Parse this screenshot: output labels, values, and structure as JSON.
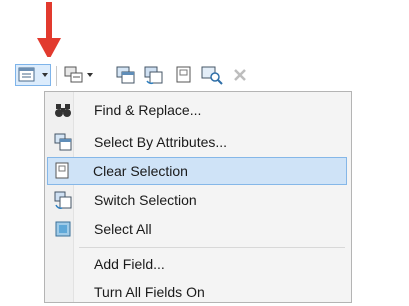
{
  "colors": {
    "arrow": "#e23a2e",
    "highlight": "#cfe3f7",
    "highlight_border": "#85b7e8"
  },
  "toolbar": {
    "buttons": [
      {
        "icon": "table-options-icon"
      },
      {
        "icon": "related-tables-icon"
      },
      {
        "icon": "select-by-attributes-icon"
      },
      {
        "icon": "switch-selection-icon"
      },
      {
        "icon": "clear-selection-icon"
      },
      {
        "icon": "zoom-to-selected-icon"
      },
      {
        "icon": "delete-selected-icon"
      }
    ]
  },
  "menu": {
    "items": [
      {
        "label": "Find & Replace...",
        "icon": "binoculars-icon"
      },
      {
        "label": "Select By Attributes...",
        "icon": "select-by-attributes-icon"
      },
      {
        "label": "Clear Selection",
        "icon": "clear-selection-icon",
        "selected": true
      },
      {
        "label": "Switch Selection",
        "icon": "switch-selection-icon"
      },
      {
        "label": "Select All",
        "icon": "select-all-icon"
      },
      {
        "label": "Add Field...",
        "icon": ""
      },
      {
        "label": "Turn All Fields On",
        "icon": ""
      }
    ]
  }
}
